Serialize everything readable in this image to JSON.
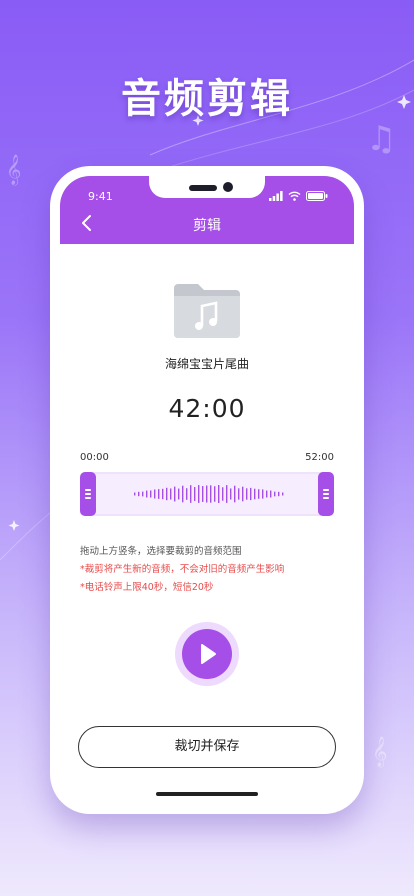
{
  "promo": {
    "headline": "音频剪辑"
  },
  "status_bar": {
    "time": "9:41"
  },
  "nav": {
    "title": "剪辑",
    "back_icon": "chevron-left-icon"
  },
  "track": {
    "name": "海绵宝宝片尾曲",
    "duration": "42:00",
    "file_icon": "music-file-icon"
  },
  "trimmer": {
    "start_time": "00:00",
    "end_time": "52:00"
  },
  "hints": {
    "line1": "拖动上方竖条，选择要裁剪的音频范围",
    "line2": "*裁剪将产生新的音频，不会对旧的音频产生影响",
    "line3": "*电话铃声上限40秒，短信20秒"
  },
  "player": {
    "play_icon": "play-icon"
  },
  "actions": {
    "save_label": "裁切并保存"
  },
  "colors": {
    "accent": "#a64ee8",
    "warning": "#e94b4b",
    "background_top": "#8a5cf6"
  }
}
